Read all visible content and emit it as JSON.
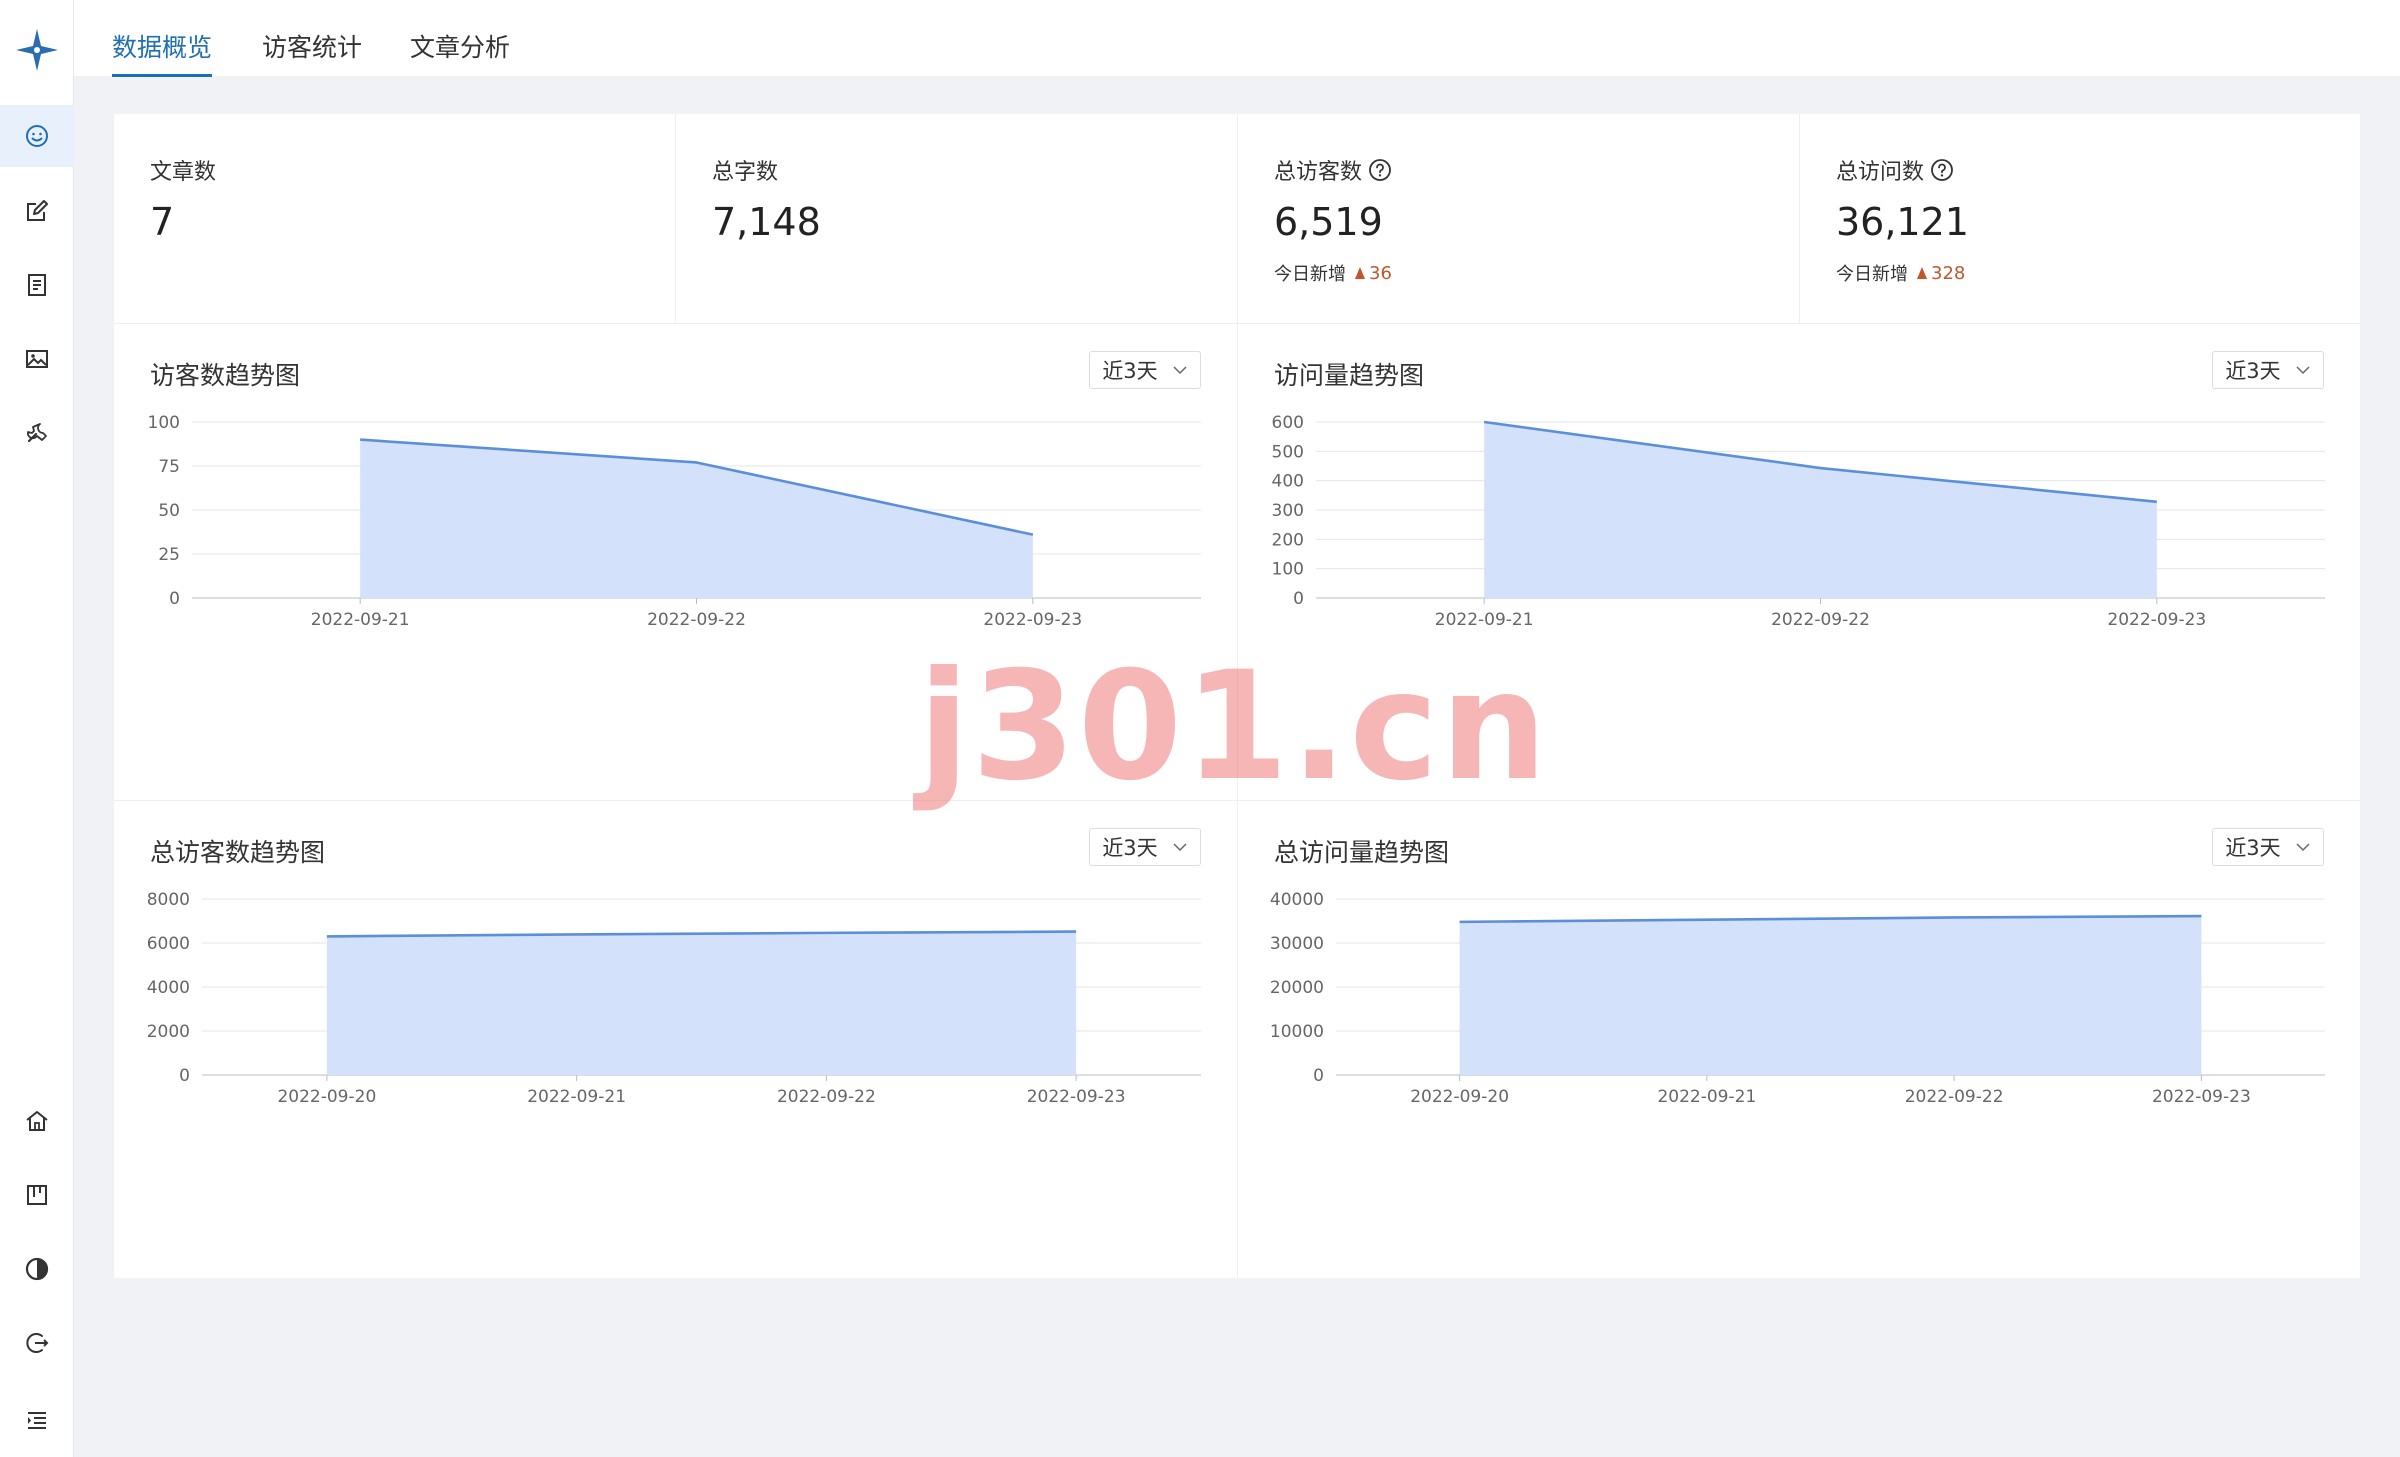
{
  "tabs": [
    {
      "label": "数据概览",
      "active": true
    },
    {
      "label": "访客统计",
      "active": false
    },
    {
      "label": "文章分析",
      "active": false
    }
  ],
  "sidebar": {
    "top_items": [
      "smile-icon",
      "edit-icon",
      "document-icon",
      "image-icon",
      "wrench-icon"
    ],
    "bottom_items": [
      "home-icon",
      "kanban-icon",
      "theme-contrast-icon",
      "logout-icon",
      "menu-collapse-icon"
    ]
  },
  "stats": [
    {
      "label": "文章数",
      "value": "7",
      "help": false,
      "sub_label": "",
      "sub_value": ""
    },
    {
      "label": "总字数",
      "value": "7,148",
      "help": false,
      "sub_label": "",
      "sub_value": ""
    },
    {
      "label": "总访客数",
      "value": "6,519",
      "help": true,
      "sub_label": "今日新增",
      "sub_value": "36"
    },
    {
      "label": "总访问数",
      "value": "36,121",
      "help": true,
      "sub_label": "今日新增",
      "sub_value": "328"
    }
  ],
  "range_label": "近3天",
  "colors": {
    "accent": "#1f6fb5",
    "line": "#5b8fd9",
    "area": "#d3e2fa",
    "increase": "#c0562a",
    "grid": "#e3e5e8"
  },
  "watermark": "j301.cn",
  "chart_data": [
    {
      "type": "area",
      "title": "访客数趋势图",
      "x": [
        "2022-09-21",
        "2022-09-22",
        "2022-09-23"
      ],
      "values": [
        90,
        77,
        36
      ],
      "ylim": [
        0,
        100
      ],
      "yticks": [
        0,
        25,
        50,
        75,
        100
      ],
      "grid": true
    },
    {
      "type": "area",
      "title": "访问量趋势图",
      "x": [
        "2022-09-21",
        "2022-09-22",
        "2022-09-23"
      ],
      "values": [
        600,
        443,
        328
      ],
      "ylim": [
        0,
        600
      ],
      "yticks": [
        0,
        100,
        200,
        300,
        400,
        500,
        600
      ],
      "grid": true
    },
    {
      "type": "area",
      "title": "总访客数趋势图",
      "x": [
        "2022-09-20",
        "2022-09-21",
        "2022-09-22",
        "2022-09-23"
      ],
      "values": [
        6300,
        6390,
        6460,
        6519
      ],
      "ylim": [
        0,
        8000
      ],
      "yticks": [
        0,
        2000,
        4000,
        6000,
        8000
      ],
      "grid": true
    },
    {
      "type": "area",
      "title": "总访问量趋势图",
      "x": [
        "2022-09-20",
        "2022-09-21",
        "2022-09-22",
        "2022-09-23"
      ],
      "values": [
        34800,
        35300,
        35800,
        36121
      ],
      "ylim": [
        0,
        40000
      ],
      "yticks": [
        0,
        10000,
        20000,
        30000,
        40000
      ],
      "grid": true
    }
  ]
}
